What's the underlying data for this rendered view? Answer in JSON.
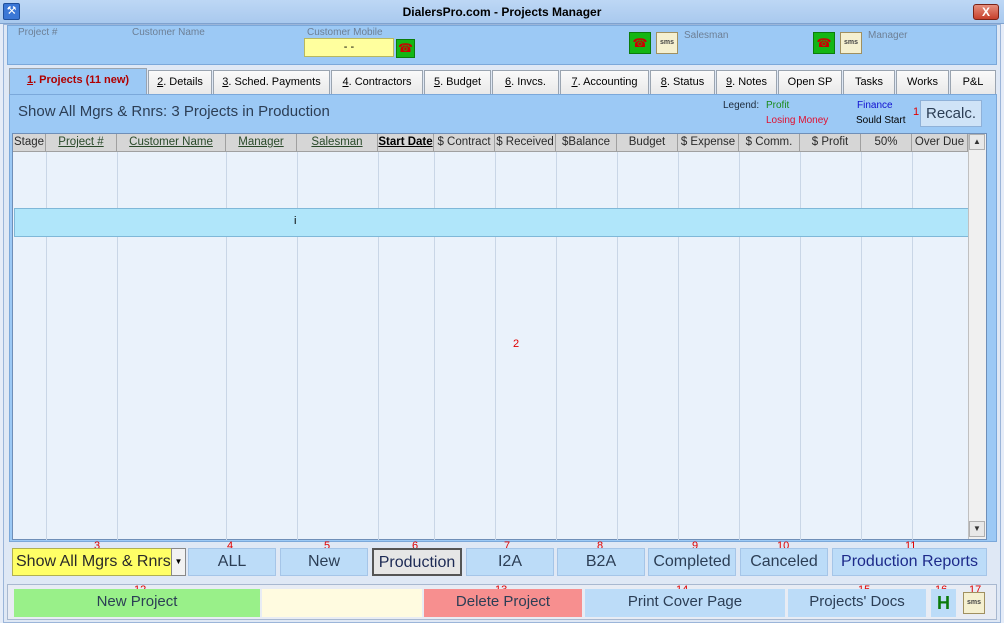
{
  "window": {
    "title": "DialersPro.com - Projects Manager",
    "close": "X"
  },
  "top": {
    "project_label": "Project #",
    "customer_label": "Customer Name",
    "mobile_label": "Customer Mobile",
    "mobile_value": "-  -",
    "salesman_label": "Salesman",
    "manager_label": "Manager",
    "sms": "sms",
    "phone": "☎"
  },
  "tabs": [
    {
      "key": "1",
      "label": ". Projects (11 new)"
    },
    {
      "key": "2",
      "label": ". Details"
    },
    {
      "key": "3",
      "label": ". Sched. Payments"
    },
    {
      "key": "4",
      "label": ". Contractors"
    },
    {
      "key": "5",
      "label": ". Budget"
    },
    {
      "key": "6",
      "label": ". Invcs."
    },
    {
      "key": "7",
      "label": ". Accounting"
    },
    {
      "key": "8",
      "label": ". Status"
    },
    {
      "key": "9",
      "label": ". Notes"
    },
    {
      "key": "",
      "label": "Open SP"
    },
    {
      "key": "",
      "label": "Tasks"
    },
    {
      "key": "",
      "label": "Works"
    },
    {
      "key": "",
      "label": "P&L"
    }
  ],
  "summary": "Show All Mgrs & Rnrs: 3 Projects in Production",
  "legend": {
    "label": "Legend:",
    "profit": "Profit",
    "finance": "Finance",
    "losing": "Losing Money",
    "should": "Sould Start",
    "colors": {
      "profit": "#1a8a1a",
      "finance": "#1010d0",
      "losing": "#e01030",
      "should": "#000000"
    }
  },
  "recalc": "Recalc.",
  "markers": [
    "1",
    "2",
    "3",
    "4",
    "5",
    "6",
    "7",
    "8",
    "9",
    "10",
    "11",
    "12",
    "13",
    "14",
    "15",
    "16",
    "17"
  ],
  "columns": [
    "Stage",
    "Project #",
    "Customer Name",
    "Manager",
    "Salesman",
    "Start Date",
    "$ Contract",
    "$ Received",
    "$Balance",
    "Budget",
    "$ Expense",
    "$ Comm.",
    "$ Profit",
    "50%",
    "Over Due"
  ],
  "row_marker": "i",
  "filters": {
    "manager_select": "Show All Mgrs & Rnrs",
    "buttons": [
      "ALL",
      "New",
      "Production",
      "I2A",
      "B2A",
      "Completed",
      "Canceled",
      "Production Reports"
    ],
    "active": "Production"
  },
  "bottom": {
    "new_project": "New Project",
    "delete_project": "Delete Project",
    "print_cover": "Print Cover Page",
    "docs": "Projects' Docs",
    "h": "H",
    "sms": "sms"
  }
}
